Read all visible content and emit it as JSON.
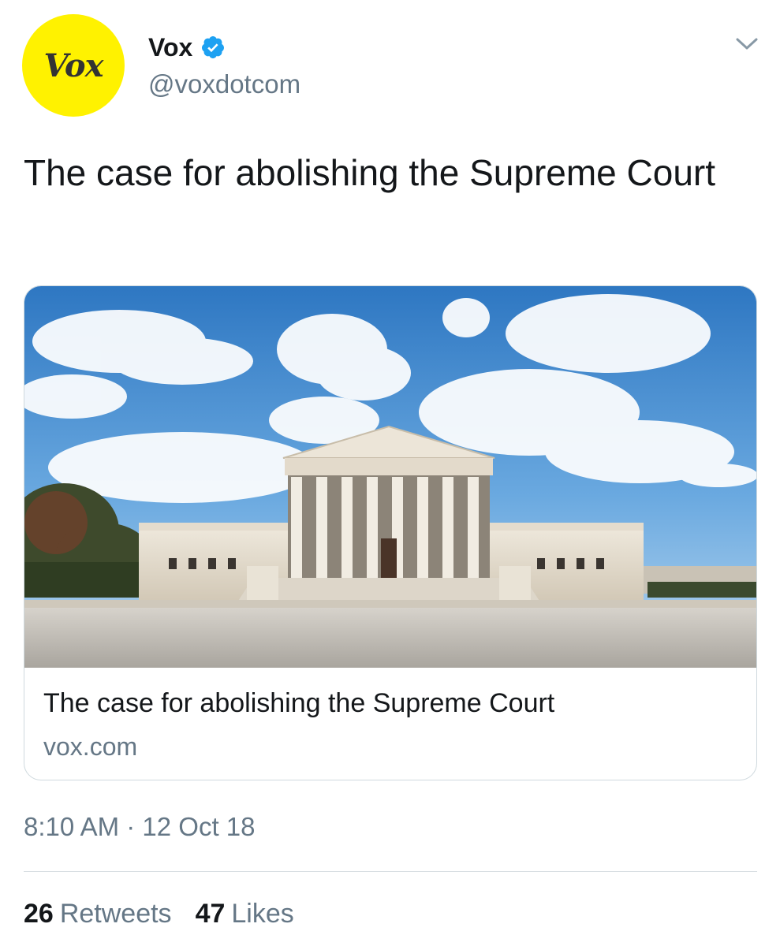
{
  "author": {
    "avatar_text": "Vox",
    "avatar_color": "#fff200",
    "name": "Vox",
    "handle": "@voxdotcom",
    "verified_icon": "verified-badge-icon",
    "verified_color": "#1da1f2"
  },
  "tweet": {
    "text": "The case for abolishing the Supreme Court"
  },
  "card": {
    "image_subject": "supreme-court-building-photo",
    "title": "The case for abolishing the Supreme Court",
    "domain": "vox.com"
  },
  "meta": {
    "timestamp": "8:10 AM · 12 Oct 18"
  },
  "stats": {
    "retweets_count": "26",
    "retweets_label": "Retweets",
    "likes_count": "47",
    "likes_label": "Likes"
  },
  "menu_icon": "chevron-down-icon"
}
